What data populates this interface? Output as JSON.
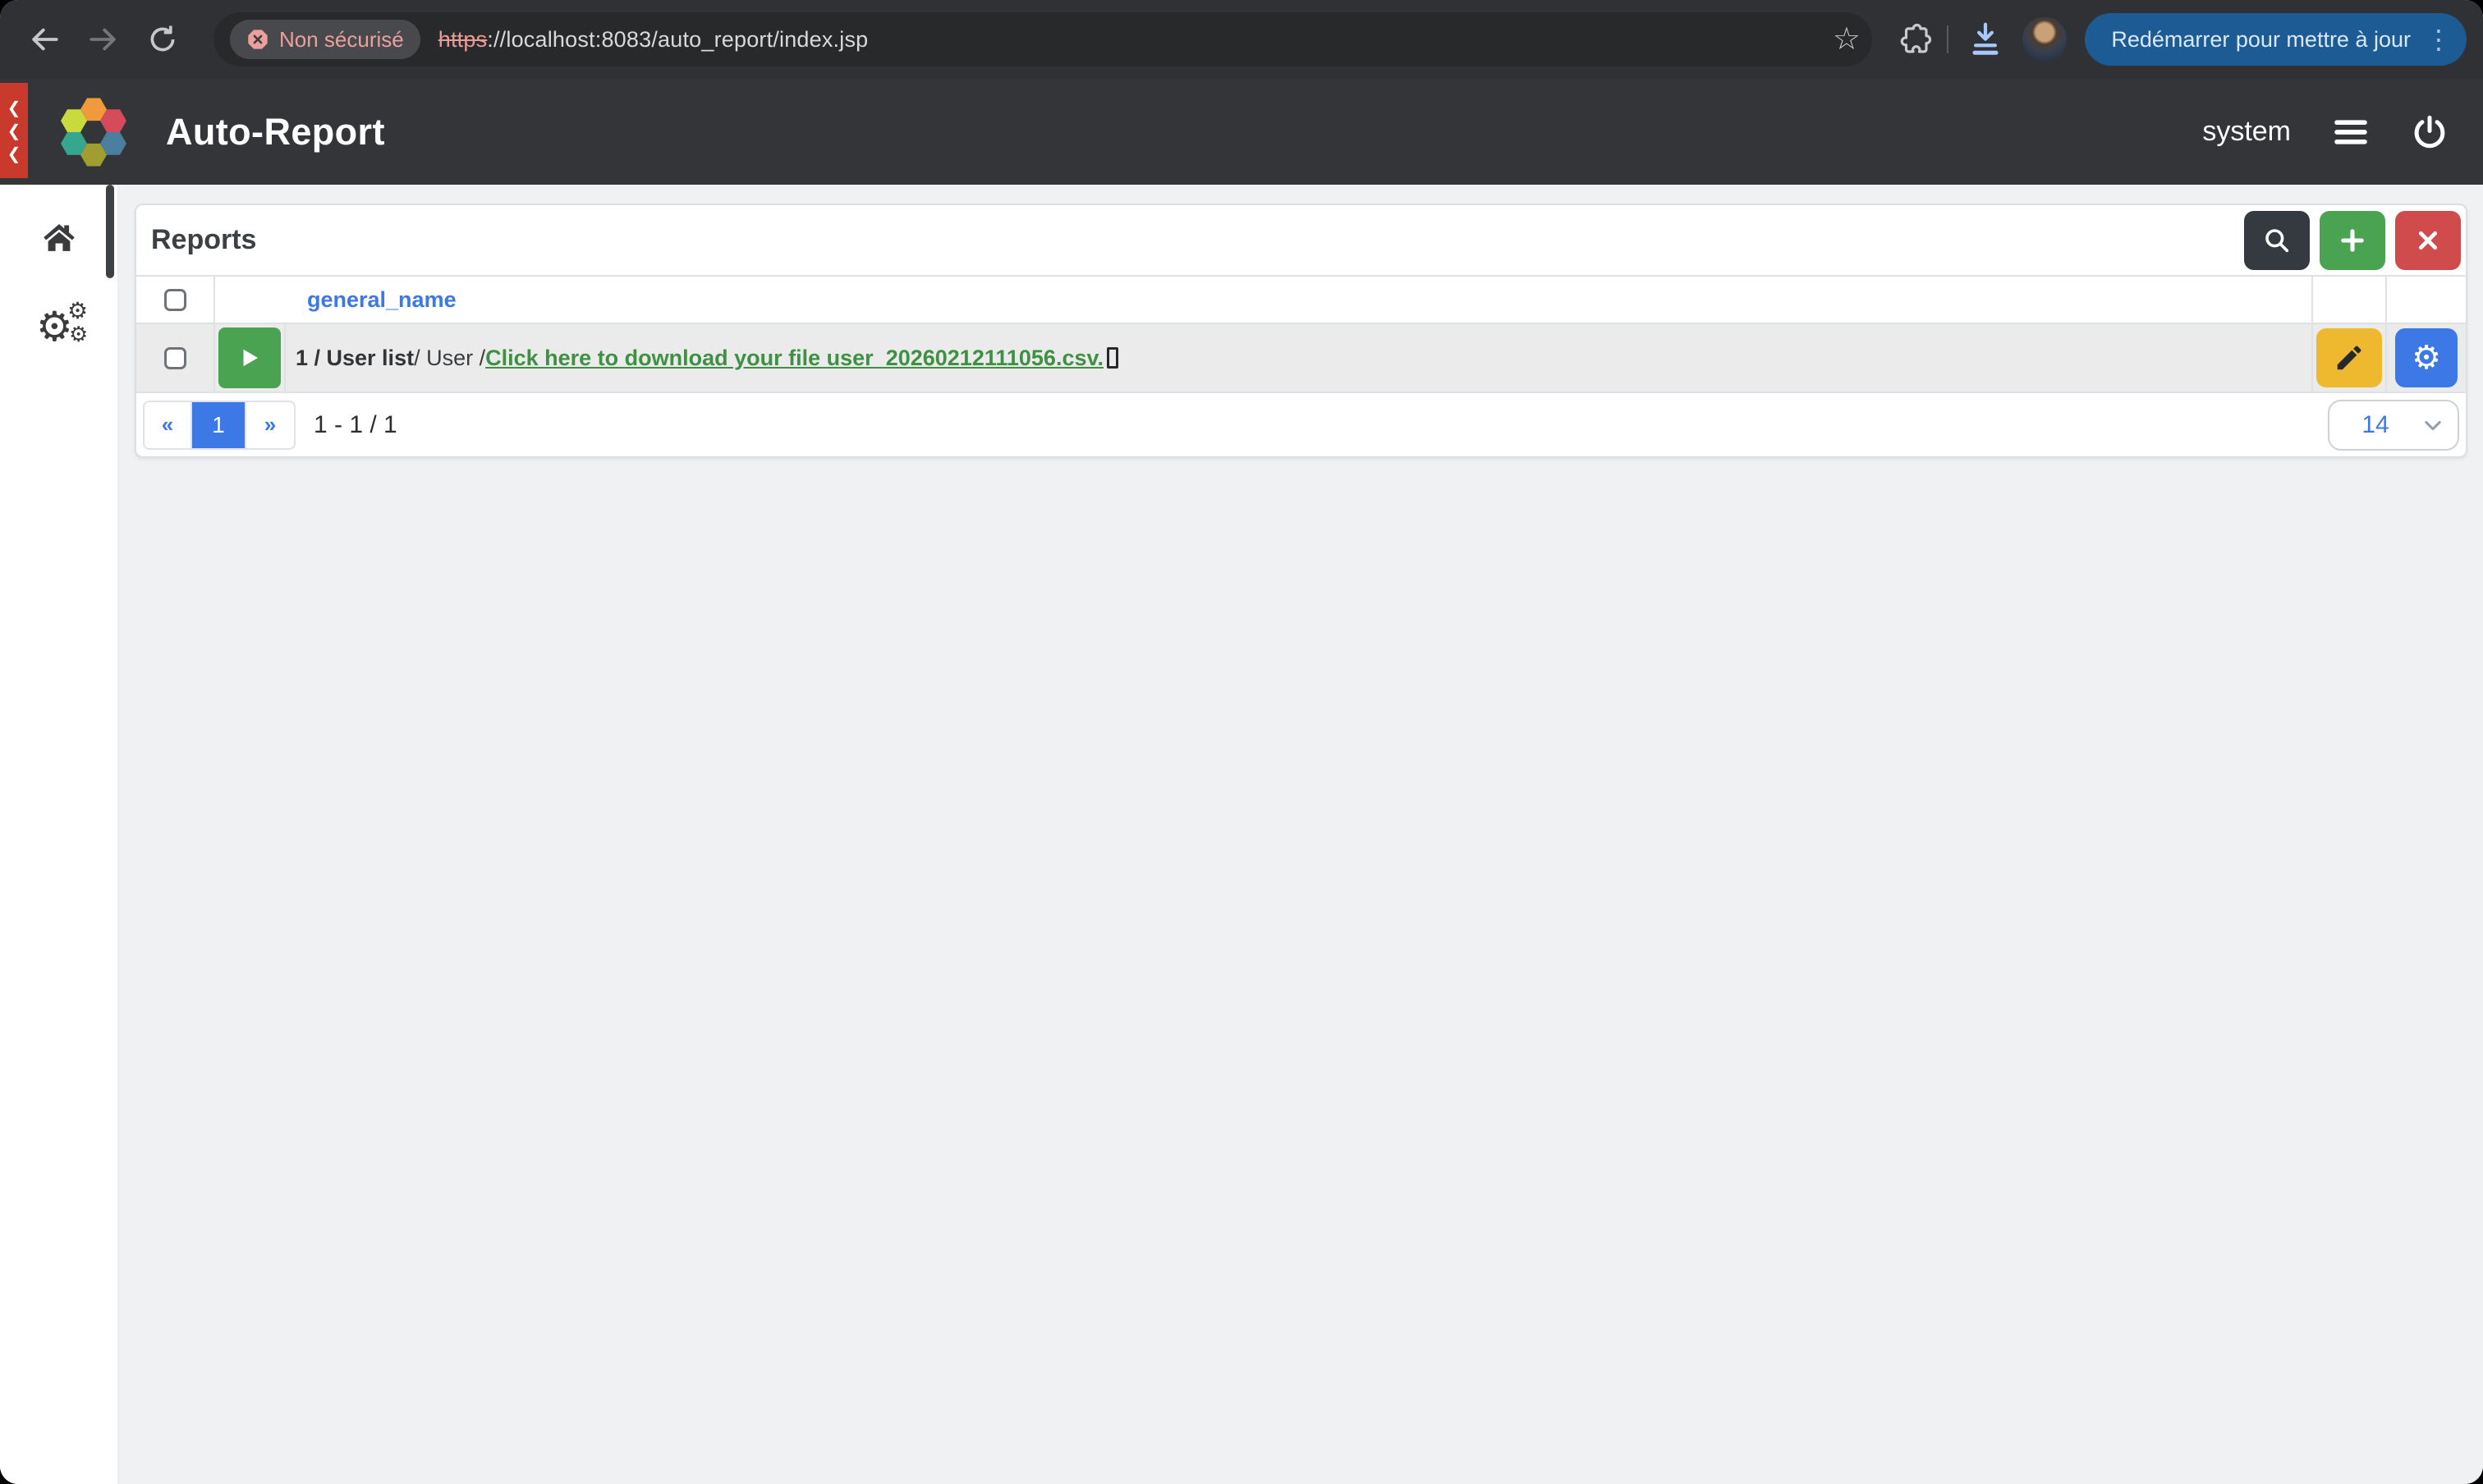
{
  "browser": {
    "security_chip": "Non sécurisé",
    "url": {
      "scheme": "https",
      "rest": "://localhost:8083/auto_report/index.jsp"
    },
    "update_button_label": "Redémarrer pour mettre à jour"
  },
  "app_header": {
    "title": "Auto-Report",
    "user": "system"
  },
  "reports": {
    "title": "Reports",
    "table": {
      "name_column_label": "general_name",
      "rows": [
        {
          "prefix_bold": "1 / User list",
          "middle": " / User / ",
          "link_text": "Click here to download your file user_20260212111056.csv."
        }
      ]
    },
    "pagination": {
      "prev": "«",
      "page": "1",
      "next": "»",
      "range_summary": "1 - 1 / 1",
      "page_size": "14"
    }
  },
  "icons": {
    "collapse_chevron": "❮",
    "kebab": "⋮",
    "star": "☆",
    "gear": "⚙"
  },
  "colors": {
    "chrome_bg": "#303134",
    "omnibox_bg": "#28292b",
    "update_pill": "#1d5b95",
    "app_header_bg": "#333539",
    "red_strip": "#c93a2c",
    "page_bg": "#eff1f3",
    "row_bg": "#ebebeb",
    "accent_blue": "#3c79e6",
    "green": "#4aa351",
    "red": "#d04b4b",
    "amber": "#efb92f",
    "dark_button": "#343a40",
    "link_green": "#3e9142",
    "insecure_pink": "#eba09c"
  }
}
